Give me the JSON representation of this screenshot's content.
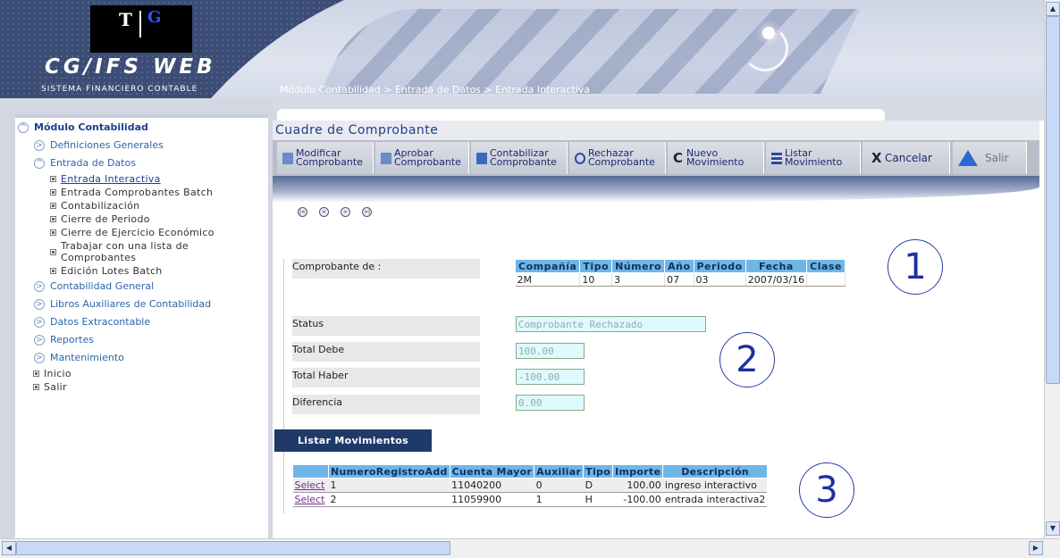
{
  "banner": {
    "logo_t": "T",
    "logo_g": "G",
    "brand": "CG/IFS WEB",
    "tagline": "SISTEMA FINANCIERO CONTABLE",
    "breadcrumb": "Módulo Contabilidad > Entrada de Datos > Entrada Interactiva"
  },
  "sidebar": {
    "module": "Módulo Contabilidad",
    "definiciones": "Definiciones Generales",
    "entrada": "Entrada de Datos",
    "sub": {
      "interactiva": "Entrada Interactiva",
      "batch": "Entrada Comprobantes Batch",
      "contabilizacion": "Contabilización",
      "cierre_periodo": "Cierre de Periodo",
      "cierre_ejercicio": "Cierre de Ejercicio Económico",
      "trabajar_1": "Trabajar con una lista de",
      "trabajar_2": "Comprobantes",
      "lotes": "Edición Lotes Batch"
    },
    "contabilidad_general": "Contabilidad General",
    "libros": "Libros Auxiliares de Contabilidad",
    "extracontable": "Datos Extracontable",
    "reportes": "Reportes",
    "mantenimiento": "Mantenimiento",
    "inicio": "Inicio",
    "salir": "Salir"
  },
  "main": {
    "title": "Cuadre de Comprobante",
    "toolbar": {
      "modificar_1": "Modificar",
      "modificar_2": "Comprobante",
      "aprobar_1": "Aprobar",
      "aprobar_2": "Comprobante",
      "contabilizar_1": "Contabilizar",
      "contabilizar_2": "Comprobante",
      "rechazar_1": "Rechazar",
      "rechazar_2": "Comprobante",
      "nuevo_1": "Nuevo",
      "nuevo_2": "Movimiento",
      "listar_1": "Listar",
      "listar_2": "Movimiento",
      "cancelar": "Cancelar",
      "salir": "Salir"
    },
    "comprobante_label": "Comprobante de :",
    "comp_table": {
      "headers": [
        "Compañía",
        "Tipo",
        "Número",
        "Año",
        "Periodo",
        "Fecha",
        "Clase"
      ],
      "row": [
        "2M",
        "10",
        "3",
        "07",
        "03",
        "2007/03/16",
        ""
      ]
    },
    "status_label": "Status",
    "status_value": "Comprobante Rechazado",
    "debe_label": "Total Debe",
    "debe_value": "100.00",
    "haber_label": "Total Haber",
    "haber_value": "-100.00",
    "diferencia_label": "Diferencia",
    "diferencia_value": "0.00",
    "annotations": [
      "1",
      "2",
      "3"
    ],
    "listar_button": "Listar Movimientos",
    "mov_table": {
      "headers": [
        "",
        "NumeroRegistroAdd",
        "Cuenta Mayor",
        "Auxiliar",
        "Tipo",
        "Importe",
        "Descripción"
      ],
      "rows": [
        [
          "Select",
          "1",
          "11040200",
          "0",
          "D",
          "100.00",
          "ingreso interactivo"
        ],
        [
          "Select",
          "2",
          "11059900",
          "1",
          "H",
          "-100.00",
          "entrada interactiva2"
        ]
      ]
    }
  }
}
